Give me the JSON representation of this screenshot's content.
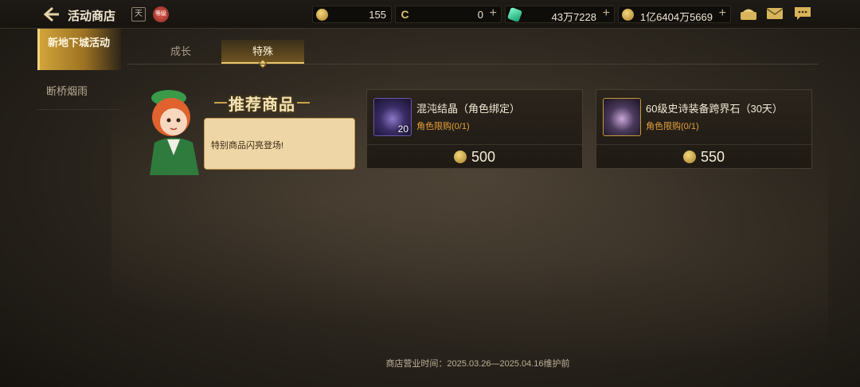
{
  "header": {
    "title": "活动商店",
    "calendar_label": "天",
    "badge_label": "等级"
  },
  "currencies": [
    {
      "icon": "gold-coin-icon",
      "value": "155",
      "has_plus": false
    },
    {
      "icon": "c-coin-icon",
      "value": "0",
      "has_plus": true
    },
    {
      "icon": "green-gem-icon",
      "value": "43万7228",
      "has_plus": true
    },
    {
      "icon": "gold-medal-icon",
      "value": "1亿6404万5669",
      "has_plus": true
    }
  ],
  "sidebar": {
    "items": [
      {
        "label": "新地下城活动",
        "active": true
      },
      {
        "label": "断桥烟雨",
        "active": false
      }
    ]
  },
  "tabs": [
    {
      "label": "成长",
      "active": false
    },
    {
      "label": "特殊",
      "active": true
    }
  ],
  "recommend": {
    "title": "推荐商品",
    "speech": "特别商品闪亮登场!"
  },
  "products": [
    {
      "name": "混沌结晶（角色绑定）",
      "limit": "角色限购(0/1)",
      "count": "20",
      "price": "500",
      "icon": "chaos-crystal-icon"
    },
    {
      "name": "60级史诗装备跨界石（30天）",
      "limit": "角色限购(0/1)",
      "count": "",
      "price": "550",
      "icon": "cross-stone-icon"
    }
  ],
  "footer": "商店营业时间：2025.03.26—2025.04.16维护前",
  "colors": {
    "accent": "#d1a43b",
    "limit": "#e8a13a",
    "text": "#e8dcc6"
  }
}
